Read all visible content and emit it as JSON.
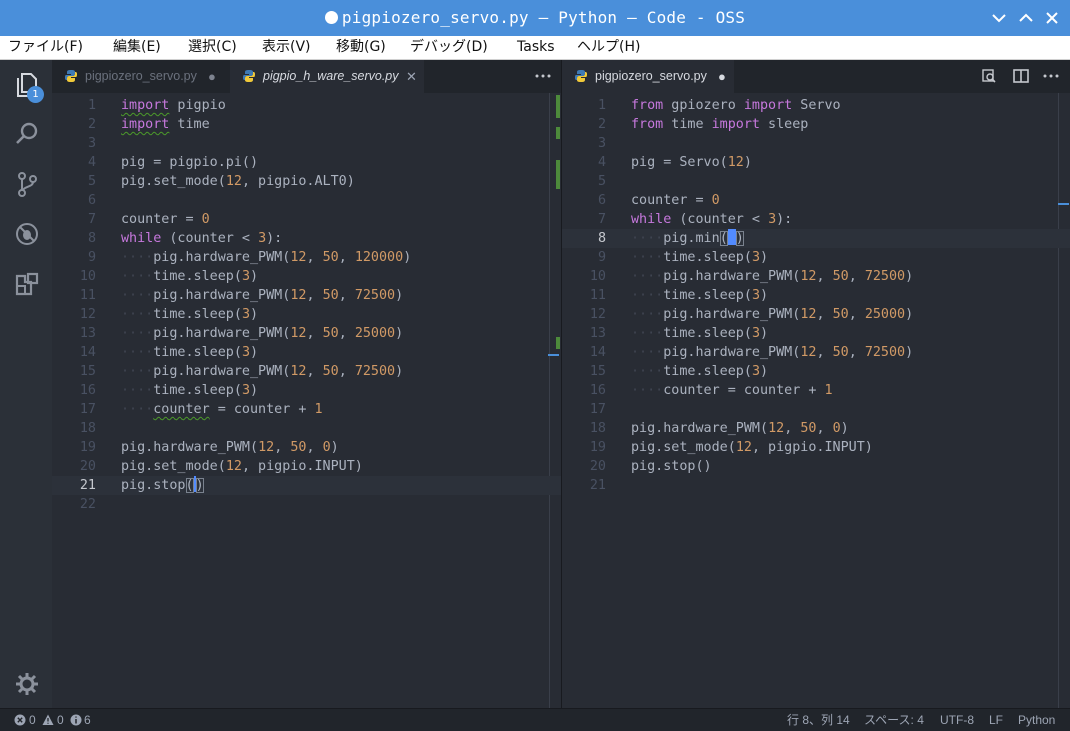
{
  "window": {
    "title": "pigpiozero_servo.py — Python — Code - OSS"
  },
  "menu": [
    "ファイル(F)",
    "編集(E)",
    "選択(C)",
    "表示(V)",
    "移動(G)",
    "デバッグ(D)",
    "Tasks",
    "ヘルプ(H)"
  ],
  "activity": {
    "explorer_badge": "1"
  },
  "left_group": {
    "tabs": [
      {
        "label": "pigpiozero_servo.py",
        "close": "●",
        "state": "inactive"
      },
      {
        "label": "pigpio_h_ware_servo.py",
        "close": "✕",
        "state": "active-preview"
      }
    ],
    "more": "···"
  },
  "right_group": {
    "tabs": [
      {
        "label": "pigpiozero_servo.py",
        "close": "●",
        "state": "active"
      }
    ]
  },
  "left_code": [
    "import pigpio",
    "import time",
    "",
    "pig = pigpio.pi()",
    "pig.set_mode(12, pigpio.ALT0)",
    "",
    "counter = 0",
    "while (counter < 3):",
    "    pig.hardware_PWM(12, 50, 120000)",
    "    time.sleep(3)",
    "    pig.hardware_PWM(12, 50, 72500)",
    "    time.sleep(3)",
    "    pig.hardware_PWM(12, 50, 25000)",
    "    time.sleep(3)",
    "    pig.hardware_PWM(12, 50, 72500)",
    "    time.sleep(3)",
    "    counter = counter + 1",
    "",
    "pig.hardware_PWM(12, 50, 0)",
    "pig.set_mode(12, pigpio.INPUT)",
    "pig.stop()",
    ""
  ],
  "right_code": [
    "from gpiozero import Servo",
    "from time import sleep",
    "",
    "pig = Servo(12)",
    "",
    "counter = 0",
    "while (counter < 3):",
    "    pig.min()",
    "    time.sleep(3)",
    "    pig.hardware_PWM(12, 50, 72500)",
    "    time.sleep(3)",
    "    pig.hardware_PWM(12, 50, 25000)",
    "    time.sleep(3)",
    "    pig.hardware_PWM(12, 50, 72500)",
    "    time.sleep(3)",
    "    counter = counter + 1",
    "",
    "pig.hardware_PWM(12, 50, 0)",
    "pig.set_mode(12, pigpio.INPUT)",
    "pig.stop()",
    ""
  ],
  "status": {
    "errors": "0",
    "warnings": "0",
    "info": "6",
    "position": "行 8、列 14",
    "spaces": "スペース: 4",
    "encoding": "UTF-8",
    "eol": "LF",
    "language": "Python"
  },
  "colors": {
    "accent": "#4a8fda",
    "keyword": "#c678dd",
    "number": "#d19a66",
    "text": "#abb2bf",
    "gutter_added": "#4d8a3b"
  }
}
